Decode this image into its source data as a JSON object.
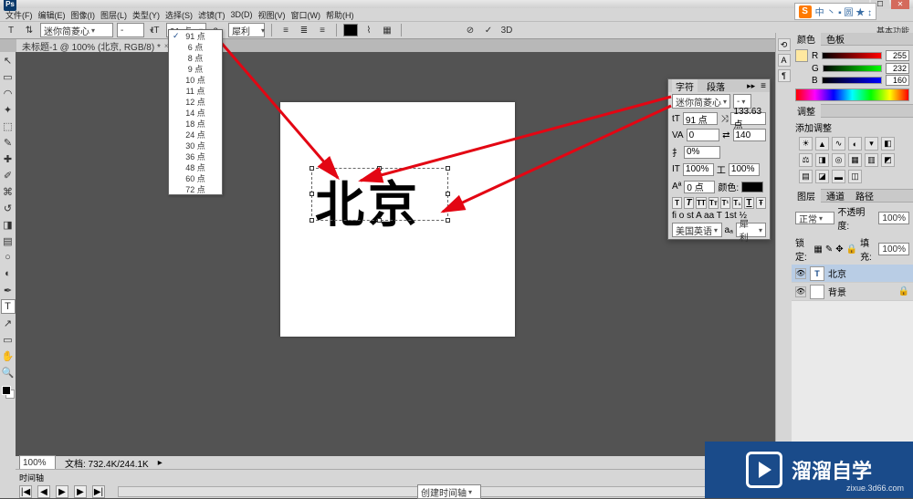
{
  "titlebar": {
    "app_icon": "Ps"
  },
  "ime": {
    "s": "S",
    "items": "中 丶 ▪ 圆 ★ ↕"
  },
  "menu": [
    "文件(F)",
    "编辑(E)",
    "图像(I)",
    "图层(L)",
    "类型(Y)",
    "选择(S)",
    "滤镜(T)",
    "3D(D)",
    "视图(V)",
    "窗口(W)",
    "帮助(H)"
  ],
  "options": {
    "font_family": "迷你简菱心",
    "font_style": "-",
    "font_size": "91 点",
    "aa": "犀利",
    "checkmark": "✓",
    "threeD": "3D",
    "right_label": "基本功能"
  },
  "doc_tab": {
    "title": "未标题-1 @ 100% (北京, RGB/8) *"
  },
  "canvas": {
    "text": "北京"
  },
  "dropdown": {
    "items": [
      "91 点",
      "6 点",
      "8 点",
      "9 点",
      "10 点",
      "11 点",
      "12 点",
      "14 点",
      "18 点",
      "24 点",
      "30 点",
      "36 点",
      "48 点",
      "60 点",
      "72 点"
    ],
    "selected_index": 0
  },
  "char_panel": {
    "tabs": [
      "字符",
      "段落"
    ],
    "font": "迷你简菱心",
    "style": "-",
    "size": "91 点",
    "leading": "133.63 点",
    "tracking": "0",
    "kerning": "140",
    "vscale": "0%",
    "baseline": "0 点",
    "hscale": "100%",
    "color_label": "颜色:",
    "t_row": "T T TT Tr T¹ T₁ T Ŧ",
    "fi": "fi  o  st  A  aa  T 1st  ½",
    "lang": "美国英语",
    "aa_label": "aₐ",
    "aa": "犀利"
  },
  "color_panel": {
    "tabs": [
      "颜色",
      "色板"
    ],
    "r": "255",
    "g": "232",
    "b": "160"
  },
  "adjust_panel": {
    "tabs": [
      "调整"
    ],
    "hint": "添加调整"
  },
  "layers": {
    "tabs": [
      "图层",
      "通道",
      "路径"
    ],
    "blend": "正常",
    "opacity_label": "不透明度:",
    "opacity": "100%",
    "lock_label": "锁定:",
    "fill_label": "填充:",
    "fill": "100%",
    "items": [
      {
        "name": "北京",
        "type": "T"
      },
      {
        "name": "背景",
        "type": "bg",
        "locked": true
      }
    ]
  },
  "status": {
    "zoom": "100%",
    "doc": "文档: 732.4K/244.1K"
  },
  "timeline": {
    "tab": "时间轴",
    "create": "创建时间轴"
  },
  "watermark": {
    "brand": "溜溜自学",
    "url": "zixue.3d66.com"
  },
  "tools": [
    "▭",
    "▯",
    "⬚",
    "✂",
    "✎",
    "✐",
    "▤",
    "◌",
    "◧",
    "✦",
    "T",
    "↖",
    "✥",
    "◯",
    "✋",
    "🔍"
  ]
}
